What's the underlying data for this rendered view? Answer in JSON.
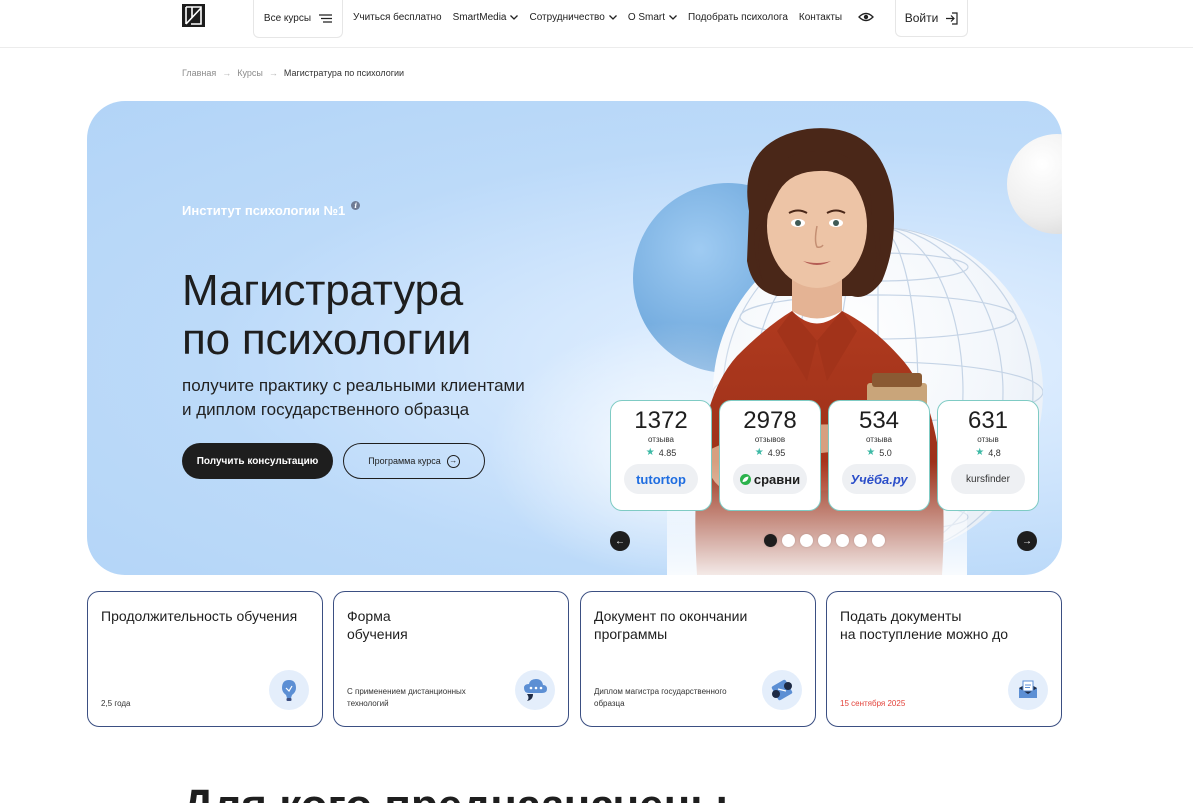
{
  "header": {
    "all_courses_label": "Все курсы",
    "nav": [
      {
        "label": "Учиться бесплатно",
        "dropdown": false
      },
      {
        "label": "SmartMedia",
        "dropdown": true
      },
      {
        "label": "Сотрудничество",
        "dropdown": true
      },
      {
        "label": "О Smart",
        "dropdown": true
      },
      {
        "label": "Подобрать психолога",
        "dropdown": false
      },
      {
        "label": "Контакты",
        "dropdown": false
      }
    ],
    "login_label": "Войти"
  },
  "breadcrumb": {
    "items": [
      "Главная",
      "Курсы"
    ],
    "separator": "→",
    "current": "Магистратура по психологии"
  },
  "hero": {
    "eyebrow": "Институт психологии №1",
    "title_line1": "Магистратура",
    "title_line2": "по психологии",
    "subtitle_line1": "получите практику с реальными клиентами",
    "subtitle_line2": "и диплом государственного образца",
    "primary_button": "Получить консультацию",
    "secondary_button": "Программа курса",
    "reviews": [
      {
        "count": "1372",
        "label": "отзыва",
        "rating": "4.85",
        "source": "tutortop",
        "logo_color": "#1f6de0"
      },
      {
        "count": "2978",
        "label": "отзывов",
        "rating": "4.95",
        "source": "сравни",
        "logo_color": "#1e1e1e"
      },
      {
        "count": "534",
        "label": "отзыва",
        "rating": "5.0",
        "source": "Учёба.ру",
        "logo_color": "#2b4ec9"
      },
      {
        "count": "631",
        "label": "отзыв",
        "rating": "4,8",
        "source": "kursfinder",
        "logo_color": "#333333"
      }
    ],
    "carousel_pages": 7,
    "carousel_active_index": 0
  },
  "info_cards": [
    {
      "title_line1": "Продолжительность обучения",
      "title_line2": "",
      "value_line1": "2,5 года",
      "value_line2": "",
      "icon": "light-bulb-icon",
      "value_color": "#333333"
    },
    {
      "title_line1": "Форма",
      "title_line2": "обучения",
      "value_line1": "С применением дистанционных",
      "value_line2": "технологий",
      "icon": "chat-cloud-icon",
      "value_color": "#333333"
    },
    {
      "title_line1": "Документ по окончании",
      "title_line2": "программы",
      "value_line1": "Диплом магистра государственного",
      "value_line2": "образца",
      "icon": "diploma-scroll-icon",
      "value_color": "#333333"
    },
    {
      "title_line1": "Подать документы",
      "title_line2": "на поступление можно до",
      "value_line1": "15 сентября 2025",
      "value_line2": "",
      "icon": "mailbox-icon",
      "value_color": "#e3423a"
    }
  ],
  "next_section_heading": "Для кого предназначены"
}
